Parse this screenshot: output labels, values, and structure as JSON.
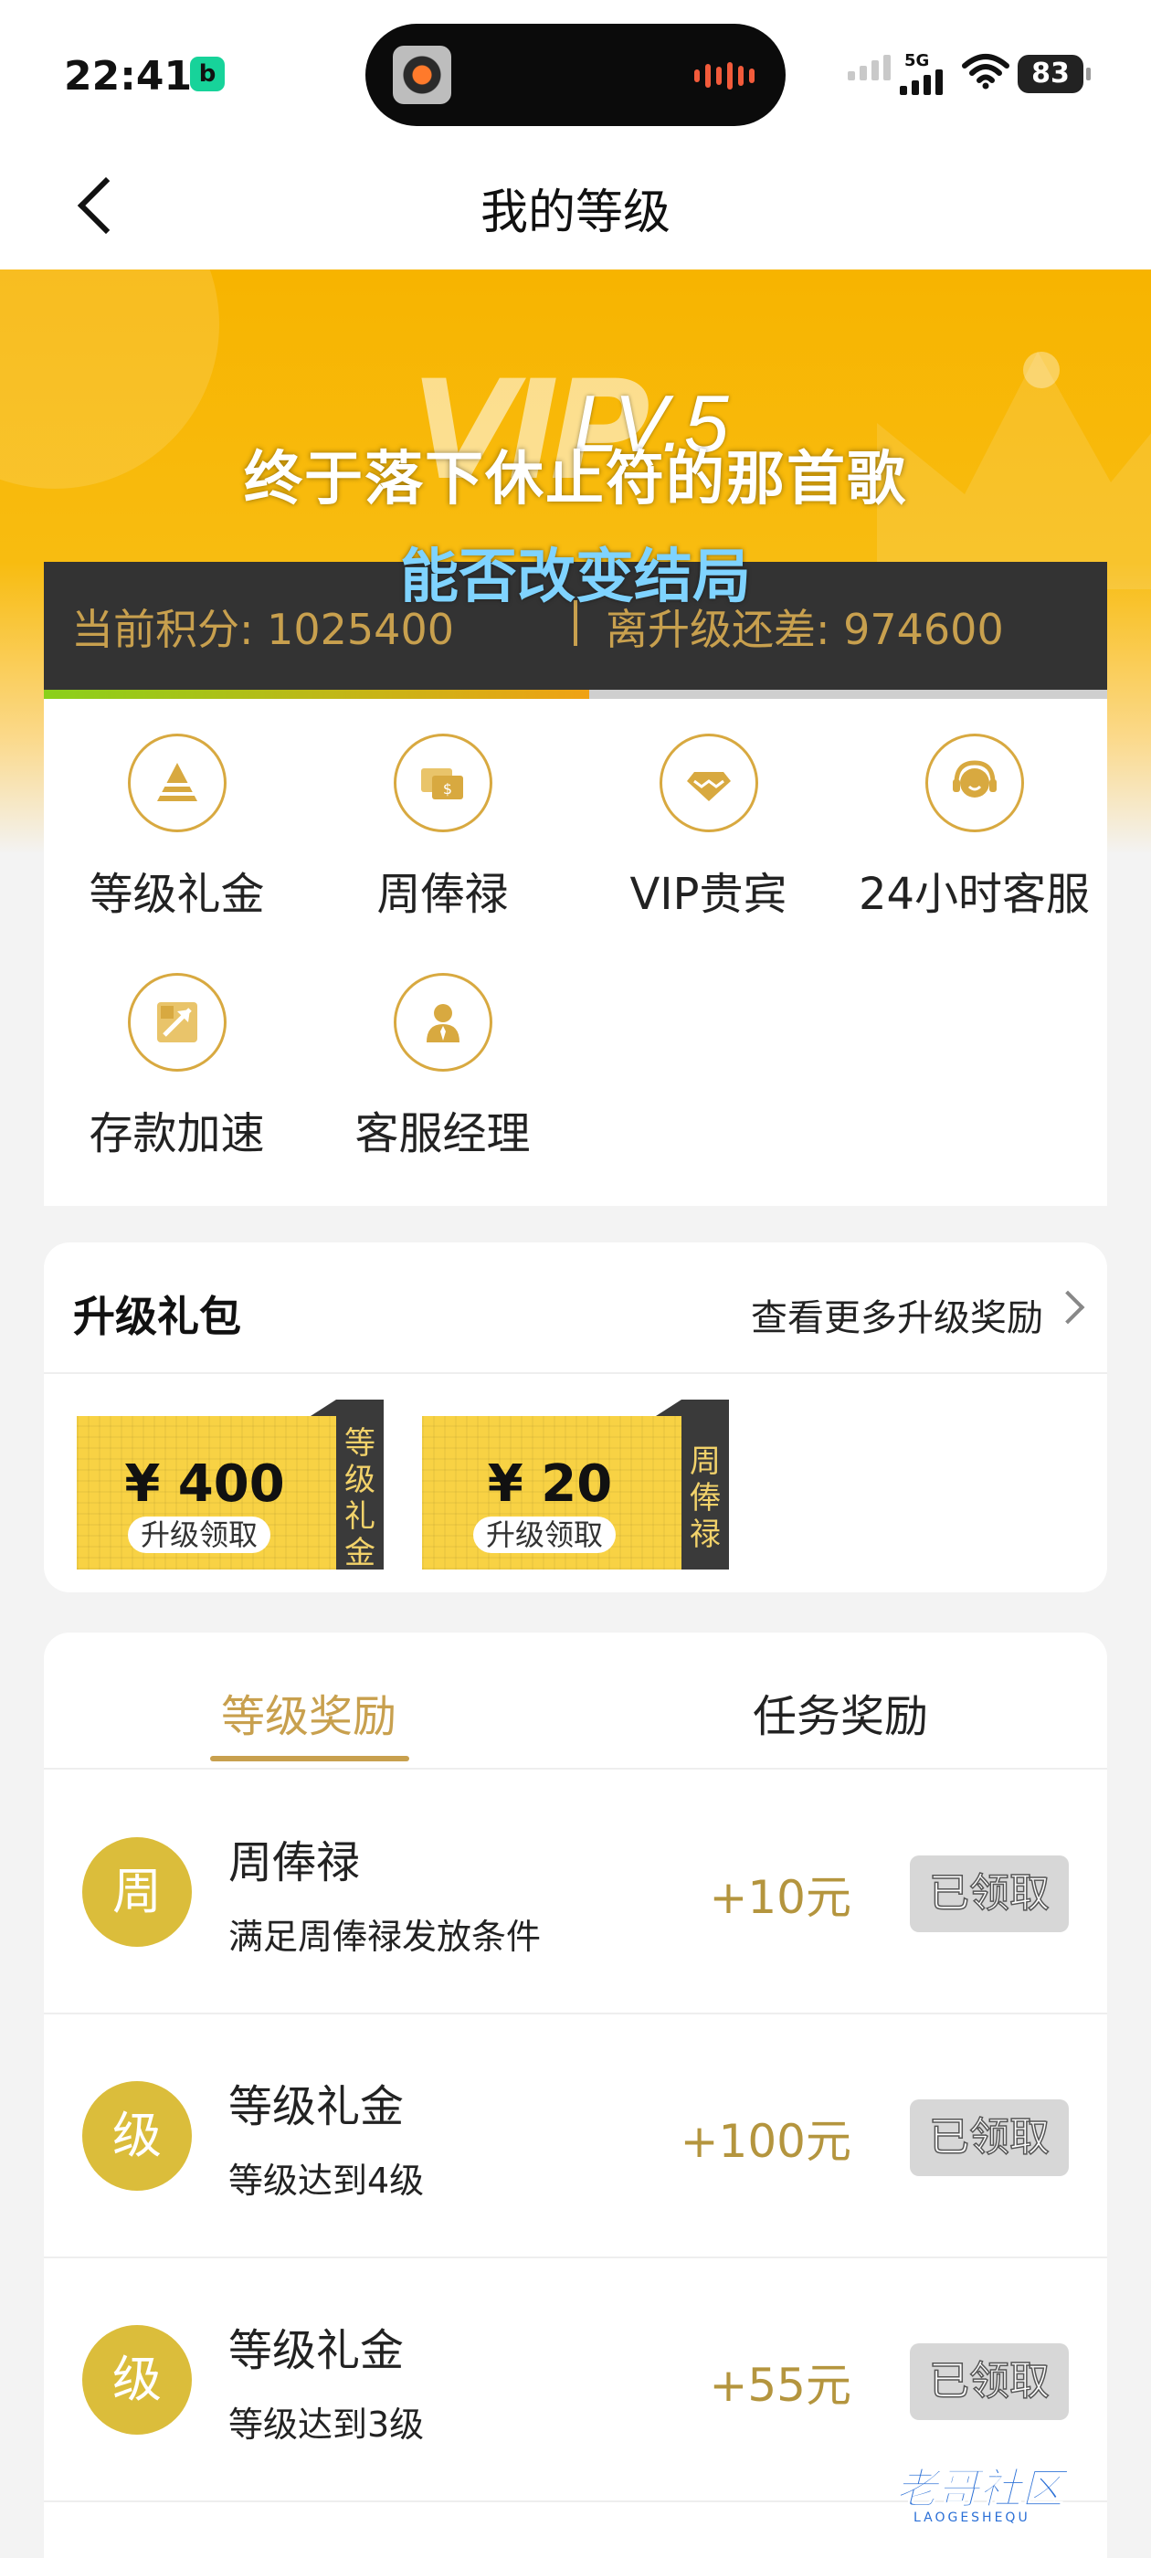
{
  "status_bar": {
    "time": "22:41",
    "network": "5G",
    "battery": "83",
    "app_badge_icon": "b-app-icon"
  },
  "nav": {
    "title": "我的等级",
    "back_icon": "chevron-left-icon"
  },
  "banner": {
    "level": "LV.5",
    "vip_mark": "VIP",
    "caption_line1": "终于落下休止符的那首歌",
    "caption_line2": "能否改变结局",
    "current_points": "当前积分: 1025400",
    "points_to_upgrade": "离升级还差: 974600",
    "progress_fraction": 0.5127
  },
  "privileges": [
    {
      "label": "等级礼金",
      "icon": "pyramid-icon"
    },
    {
      "label": "周俸禄",
      "icon": "money-card-icon"
    },
    {
      "label": "VIP贵宾",
      "icon": "diamond-icon"
    },
    {
      "label": "24小时客服",
      "icon": "headset-icon"
    },
    {
      "label": "存款加速",
      "icon": "rocket-icon"
    },
    {
      "label": "客服经理",
      "icon": "manager-icon"
    }
  ],
  "upgrade_gift": {
    "title": "升级礼包",
    "more_label": "查看更多升级奖励",
    "coupons": [
      {
        "amount": "¥ 400",
        "sub": "升级领取",
        "tag": "等级礼金"
      },
      {
        "amount": "¥ 20",
        "sub": "升级领取",
        "tag": "周俸禄"
      }
    ]
  },
  "rewards": {
    "tabs": [
      "等级奖励",
      "任务奖励"
    ],
    "active_tab": 0,
    "rows": [
      {
        "badge": "周",
        "title": "周俸禄",
        "desc": "满足周俸禄发放条件",
        "amount": "+10元",
        "button": "已领取"
      },
      {
        "badge": "级",
        "title": "等级礼金",
        "desc": "等级达到4级",
        "amount": "+100元",
        "button": "已领取"
      },
      {
        "badge": "级",
        "title": "等级礼金",
        "desc": "等级达到3级",
        "amount": "+55元",
        "button": "已领取"
      }
    ]
  },
  "watermark": {
    "text": "老哥社区",
    "sub": "LAOGESHEQU"
  },
  "colors": {
    "accent_gold": "#c8a04e",
    "banner_yellow": "#f7b400",
    "badge_gold": "#dbbd3b"
  }
}
